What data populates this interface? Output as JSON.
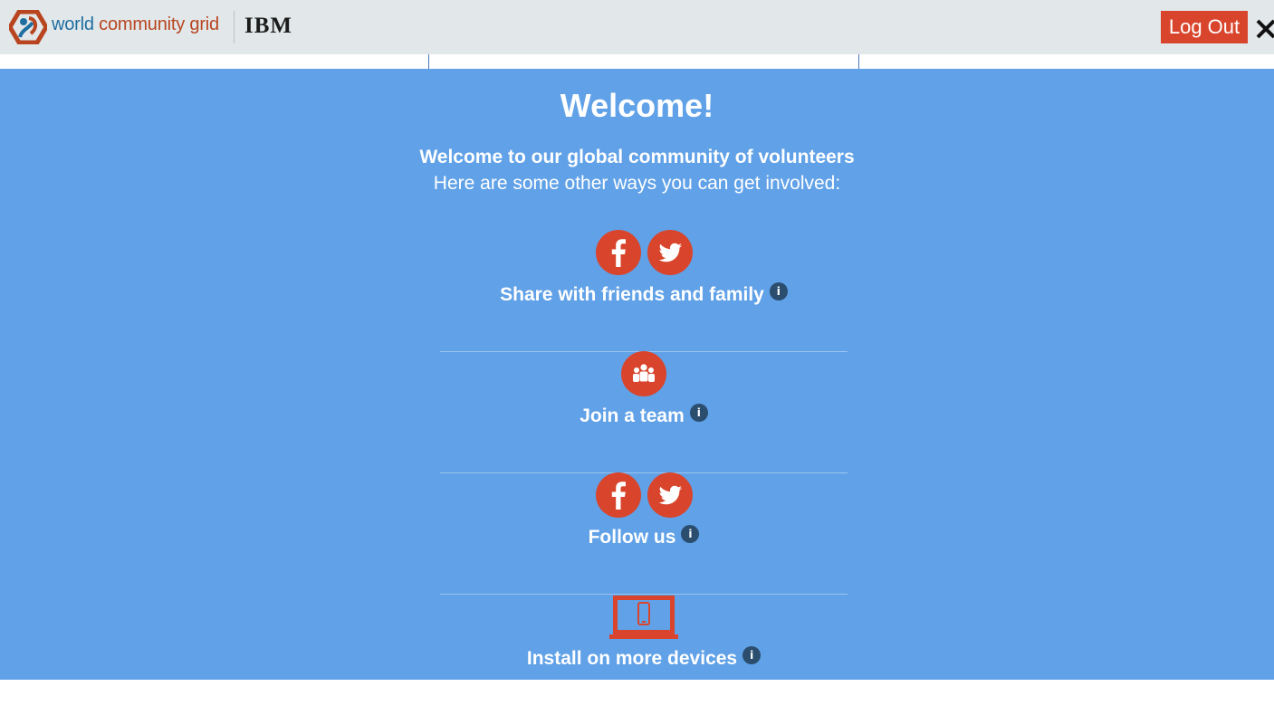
{
  "header": {
    "brand_world": "world",
    "brand_rest": " community grid",
    "partner": "IBM",
    "logout_label": "Log Out",
    "close_symbol": "✕",
    "colors": {
      "bar": "#e2e8ea",
      "accent": "#d8452c",
      "brand_blue": "#1f6ea0",
      "brand_orange": "#b8451f"
    }
  },
  "welcome": {
    "title": "Welcome!",
    "subtitle": "Welcome to our global community of volunteers",
    "subtext": "Here are some other ways you can get involved:",
    "panel_color": "#60a1e7"
  },
  "sections": [
    {
      "label": "Share with friends and family",
      "icons": [
        "facebook-icon",
        "twitter-icon"
      ],
      "info": "i"
    },
    {
      "label": "Join a team",
      "icons": [
        "team-icon"
      ],
      "info": "i"
    },
    {
      "label": "Follow us",
      "icons": [
        "facebook-icon",
        "twitter-icon"
      ],
      "info": "i"
    },
    {
      "label": "Install on more devices",
      "icons": [
        "laptop-phone-icon"
      ],
      "info": "i"
    }
  ]
}
